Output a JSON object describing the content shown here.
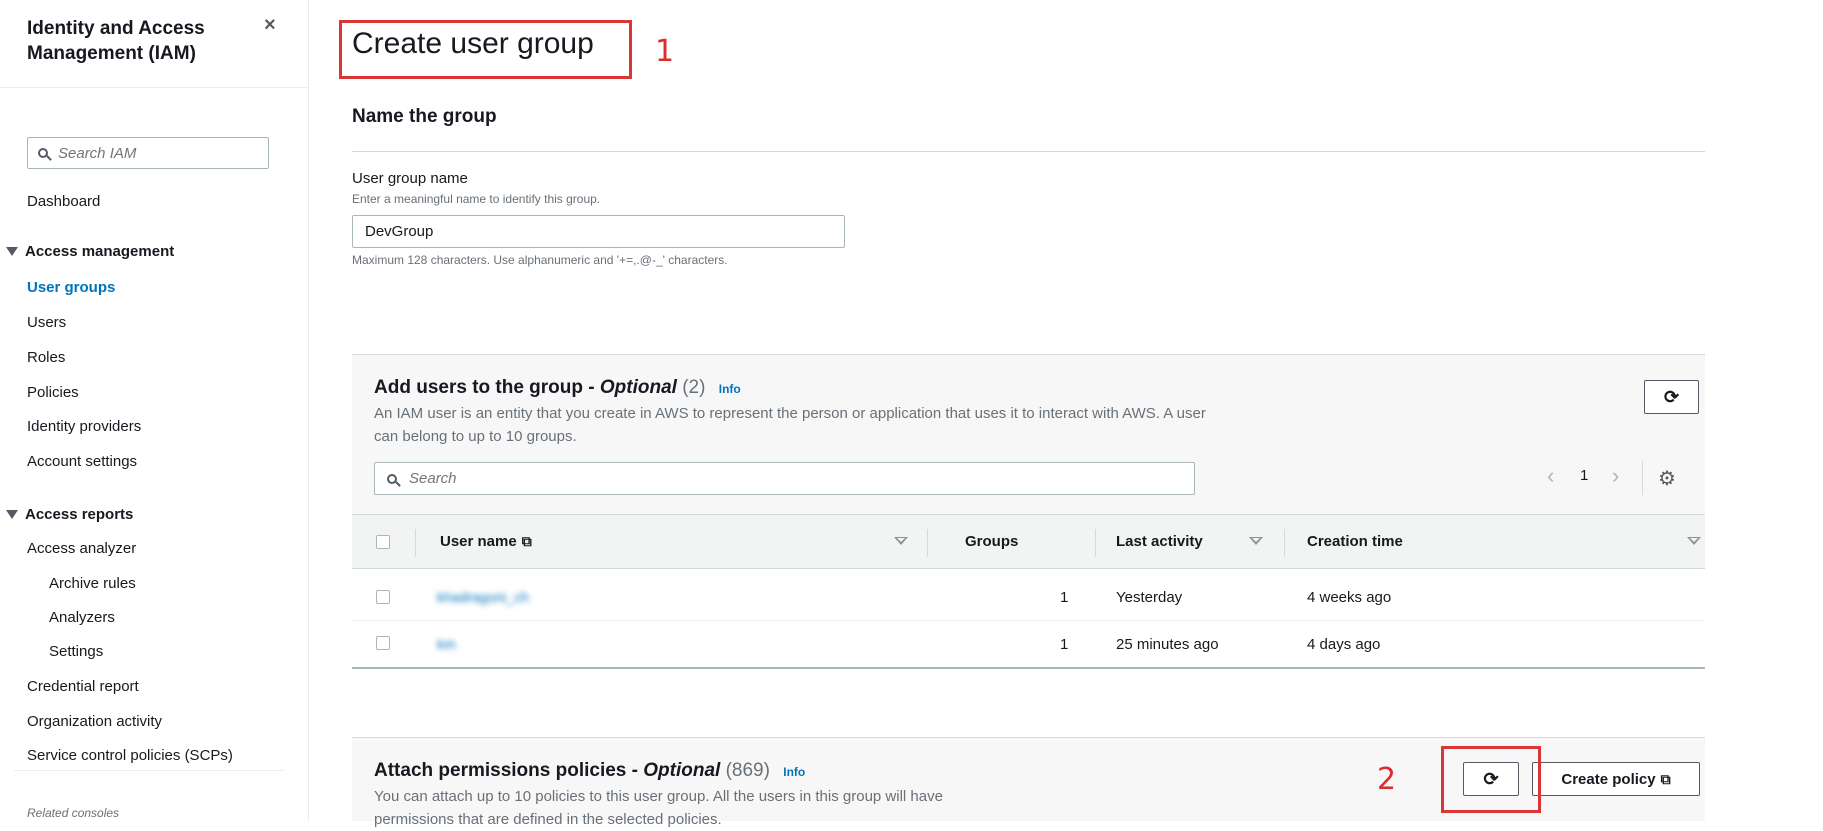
{
  "sidebar": {
    "title": "Identity and Access Management (IAM)",
    "close_icon": "×",
    "search_placeholder": "Search IAM",
    "dashboard": "Dashboard",
    "access_management": {
      "label": "Access management",
      "items": [
        "User groups",
        "Users",
        "Roles",
        "Policies",
        "Identity providers",
        "Account settings"
      ],
      "active": "User groups"
    },
    "access_reports": {
      "label": "Access reports",
      "access_analyzer": "Access analyzer",
      "analyzer_subitems": [
        "Archive rules",
        "Analyzers",
        "Settings"
      ],
      "more_items": [
        "Credential report",
        "Organization activity",
        "Service control policies (SCPs)"
      ]
    },
    "related_consoles": "Related consoles"
  },
  "page": {
    "title": "Create user group"
  },
  "annotations": [
    "1",
    "2"
  ],
  "name_section": {
    "heading": "Name the group",
    "label": "User group name",
    "description": "Enter a meaningful name to identify this group.",
    "value": "DevGroup",
    "constraint": "Maximum 128 characters. Use alphanumeric and '+=,.@-_' characters."
  },
  "add_users": {
    "title": "Add users to the group - ",
    "optional": "Optional",
    "count": "(2)",
    "info": "Info",
    "description": "An IAM user is an entity that you create in AWS to represent the person or application that uses it to interact with AWS. A user can belong to up to 10 groups.",
    "search_placeholder": "Search",
    "page": "1",
    "prev_icon": "‹",
    "next_icon": "›",
    "settings_icon": "gear-icon",
    "columns": [
      "User name",
      "Groups",
      "Last activity",
      "Creation time"
    ],
    "rows": [
      {
        "user": "khadragoni_ch",
        "groups": "1",
        "last_activity": "Yesterday",
        "creation": "4 weeks ago"
      },
      {
        "user": "km",
        "groups": "1",
        "last_activity": "25 minutes ago",
        "creation": "4 days ago"
      }
    ]
  },
  "attach_policies": {
    "title": "Attach permissions policies - ",
    "optional": "Optional",
    "count": "(869)",
    "info": "Info",
    "description": "You can attach up to 10 policies to this user group. All the users in this group will have permissions that are defined in the selected policies.",
    "create_policy": "Create policy"
  },
  "colors": {
    "link": "#0073bb",
    "annotation": "#d93636",
    "text": "#16191f",
    "muted": "#687078"
  }
}
